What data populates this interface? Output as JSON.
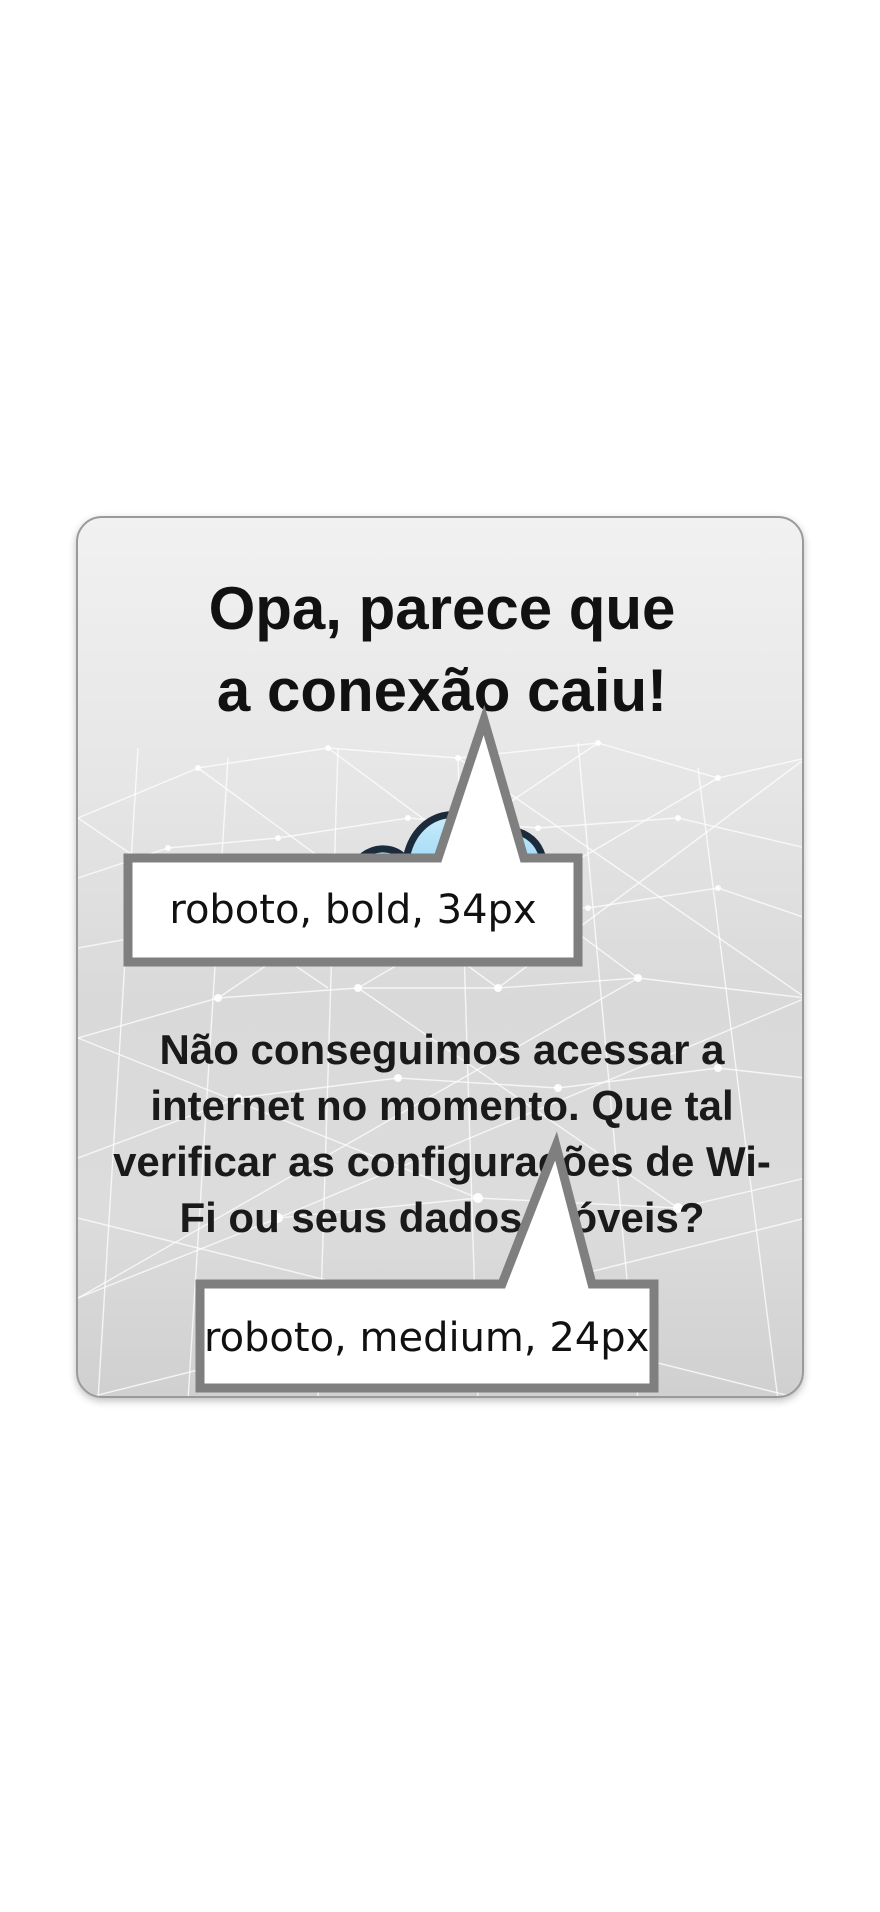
{
  "dialog": {
    "title_line1": "Opa, parece que",
    "title_line2": "a conexão caiu!",
    "message": "Não conseguimos acessar a internet no momento. Que tal verificar as configurações de Wi-Fi ou seus dados móveis?",
    "icon": "cloud-icon"
  },
  "annotations": {
    "title_font": "roboto, bold, 34px",
    "message_font": "roboto, medium, 24px"
  },
  "colors": {
    "card_border": "#9a9a9a",
    "callout_border": "#7f7f7f",
    "cloud_fill": "#8fd3f4",
    "cloud_outline": "#1b2b3b"
  }
}
